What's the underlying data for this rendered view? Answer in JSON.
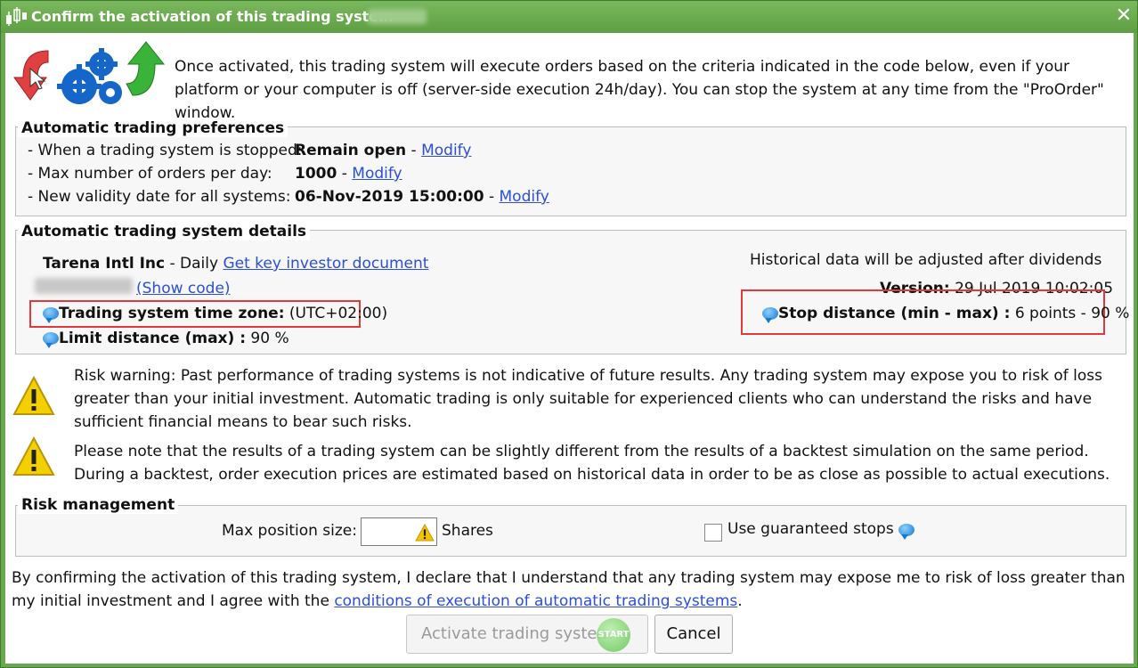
{
  "window": {
    "title": "Confirm the activation of this trading system -",
    "close_label": "✕"
  },
  "intro": {
    "text": "Once activated, this trading system will execute orders based on the criteria indicated in the code below, even if your platform or your computer is off (server-side execution 24h/day). You can stop the system at any time from the \"ProOrder\" window."
  },
  "preferences": {
    "title": "Automatic trading preferences",
    "rows": [
      {
        "label": "- When a trading system is stopped:",
        "value": "Remain open",
        "sep": " -",
        "link": "Modify"
      },
      {
        "label": "- Max number of orders per day:",
        "value": "1000",
        "sep": " -",
        "link": "Modify"
      },
      {
        "label": "- New validity date for all systems:",
        "value": "06-Nov-2019 15:00:00",
        "sep": " -",
        "link": "Modify"
      }
    ]
  },
  "details": {
    "title": "Automatic trading system details",
    "instrument": "Tarena Intl Inc",
    "timeframe": " - Daily ",
    "kid_link": "Get key investor document",
    "show_code": "(Show code)",
    "timezone_label": "Trading system time zone:",
    "timezone_value": " (UTC+02:00)",
    "limit_label": "Limit distance (max) :",
    "limit_value": " 90 %",
    "historical": "Historical data will be adjusted after dividends",
    "version_label": "Version:",
    "version_value": " 29 Jul 2019 10:02:05",
    "stop_label": "Stop distance (min - max) :",
    "stop_value": " 6 points - 90 %"
  },
  "warnings": [
    {
      "text": "Risk warning: Past performance of trading systems is not indicative of future results. Any trading system may expose you to risk of loss greater than your initial investment. Automatic trading is only suitable for experienced clients who can understand the risks and have sufficient financial means to bear such risks."
    },
    {
      "text": "Please note that the results of a trading system can be slightly different from the results of a backtest simulation on the same period. During a backtest, order execution prices are estimated based on historical data in order to be as close as possible to actual executions."
    }
  ],
  "risk": {
    "title": "Risk management",
    "max_position_label": "Max position size:",
    "max_position_value": "",
    "shares_label": "Shares",
    "guaranteed_label": "Use guaranteed stops"
  },
  "declaration": {
    "text": "By confirming the activation of this trading system, I declare that I understand that any trading system may expose me to risk of loss greater than my initial investment and I agree with the ",
    "link": "conditions of execution of automatic trading systems",
    "end": "."
  },
  "buttons": {
    "activate": "Activate trading system",
    "start_badge": "START",
    "cancel": "Cancel"
  },
  "colors": {
    "titlebar": "#6aa84f",
    "link": "#2b4fd6",
    "highlight": "#e23a3a"
  }
}
